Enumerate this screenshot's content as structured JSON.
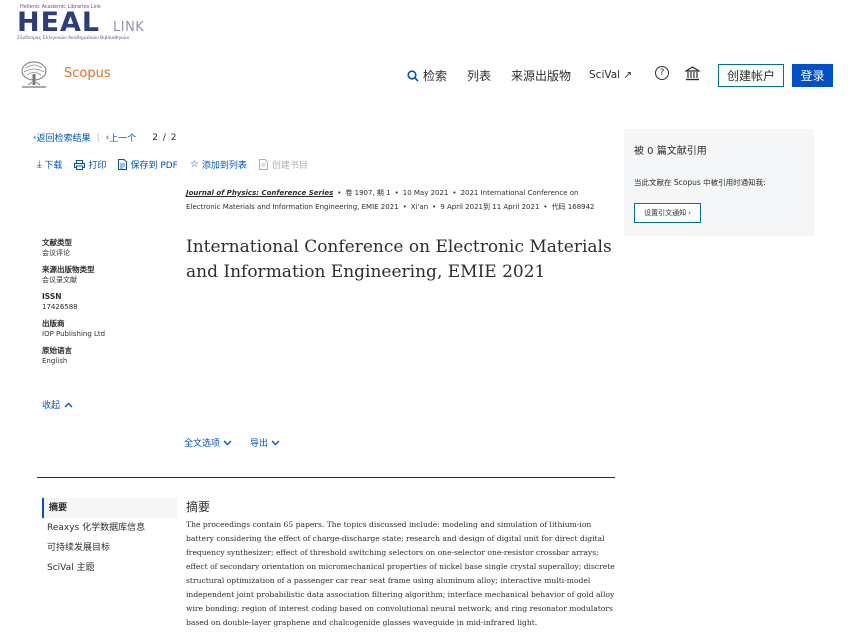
{
  "header": {
    "heal_top": "Hellenic Academic Libraries Link",
    "heal_main": "HEAL",
    "heal_link": "LINK",
    "heal_bottom": "Σύνδεσμος Ελληνικών Ακαδημαϊκών Βιβλιοθηκών",
    "brand": "Scopus"
  },
  "nav": {
    "search": "检索",
    "lists": "列表",
    "sources": "来源出版物",
    "scival": "SciVal ↗",
    "help_icon": "question-circle-icon",
    "institution_icon": "institution-icon",
    "create_account": "创建帐户",
    "login": "登录"
  },
  "breadcrumb": {
    "back": "返回检索结果",
    "prev": "上一个",
    "page": "2 / 2"
  },
  "actions": {
    "download": "下载",
    "print": "打印",
    "save_pdf": "保存到 PDF",
    "add_list": "添加到列表",
    "create_bib": "创建书目"
  },
  "meta": {
    "journal": "Journal of Physics: Conference Series",
    "volume": "卷 1907, 期 1",
    "date": "10 May 2021",
    "conference": "2021 International Conference on Electronic Materials and Information Engineering, EMIE 2021",
    "location": "Xi'an",
    "conf_dates": "9 April 2021到 11 April 2021",
    "code": "代码 168942"
  },
  "title": "International Conference on Electronic Materials and Information Engineering, EMIE 2021",
  "side_meta": {
    "doc_type_label": "文献类型",
    "doc_type": "会议评论",
    "source_type_label": "来源出版物类型",
    "source_type": "会议录文献",
    "issn_label": "ISSN",
    "issn": "17426588",
    "publisher_label": "出版商",
    "publisher": "IOP Publishing Ltd",
    "language_label": "原始语言",
    "language": "English",
    "collapse": "收起"
  },
  "fulltext": {
    "options": "全文选项",
    "export": "导出"
  },
  "sections": {
    "items": [
      {
        "label": "摘要"
      },
      {
        "label": "Reaxys 化学数据库信息"
      },
      {
        "label": "可持续发展目标"
      },
      {
        "label": "SciVal 主题"
      }
    ]
  },
  "abstract": {
    "heading": "摘要",
    "text": "The proceedings contain 65 papers. The topics discussed include: modeling and simulation of lithium-ion battery considering the effect of charge-discharge state; research and design of digital unit for direct digital frequency synthesizer; effect of threshold switching selectors on one-selector one-resistor crossbar arrays; effect of secondary orientation on micromechanical properties of nickel base single crystal superalloy; discrete structural optimization of a passenger car rear seat frame using aluminum alloy; interactive multi-model independent joint probabilistic data association filtering algorithm; interface mechanical behavior of gold alloy wire bonding; region of interest coding based on convolutional neural network; and ring resonator modulators based on double-layer graphene and chalcogenide glasses waveguide in mid-infrared light."
  },
  "citations": {
    "title": "被 0 篇文献引用",
    "desc": "当此文献在 Scopus 中被引用时通知我:",
    "button": "设置引文通知"
  },
  "colors": {
    "link": "#0050c8",
    "brand": "#e9711c",
    "primary_button": "#0050c8",
    "panel": "#f4f6f8"
  }
}
